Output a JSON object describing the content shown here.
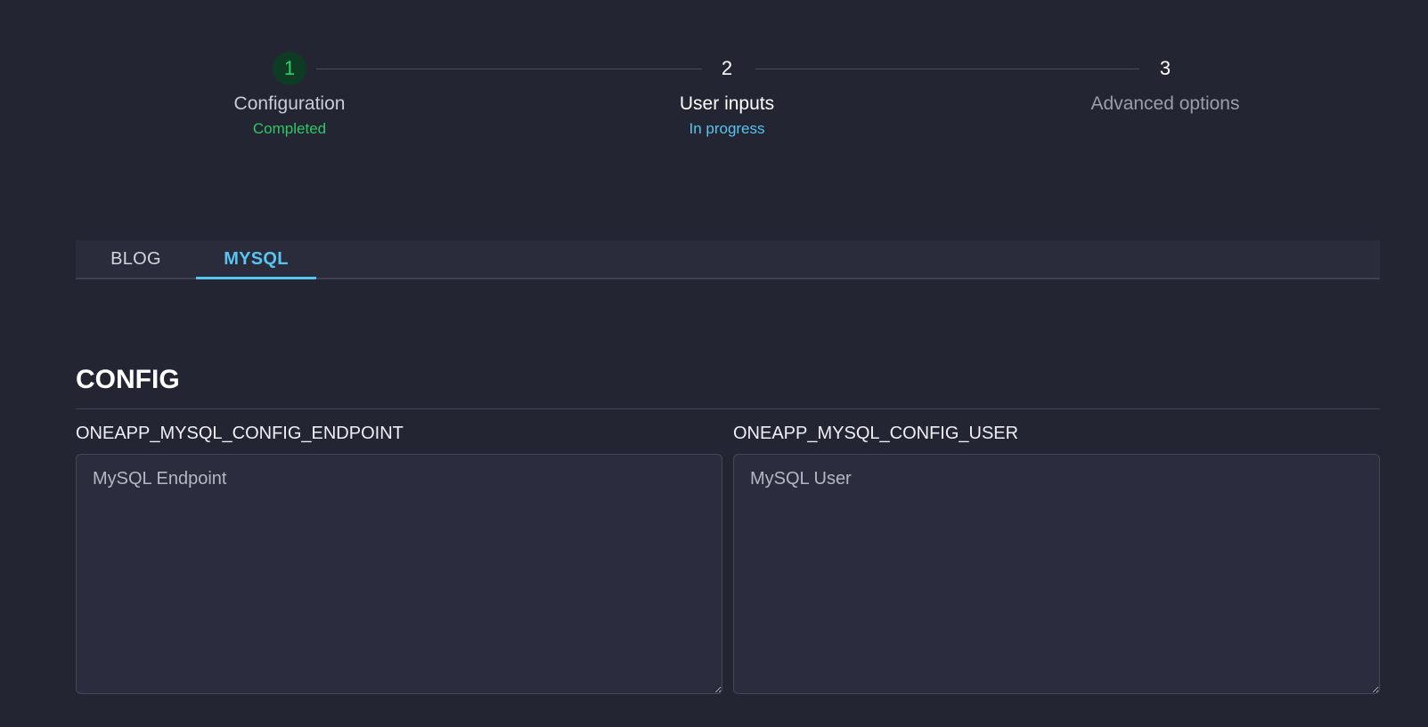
{
  "stepper": {
    "steps": [
      {
        "number": "1",
        "title": "Configuration",
        "status": "Completed",
        "state": "completed"
      },
      {
        "number": "2",
        "title": "User inputs",
        "status": "In progress",
        "state": "active"
      },
      {
        "number": "3",
        "title": "Advanced options",
        "status": "",
        "state": "pending"
      }
    ]
  },
  "tabs": [
    {
      "label": "BLOG",
      "active": false
    },
    {
      "label": "MYSQL",
      "active": true
    }
  ],
  "section": {
    "title": "CONFIG",
    "fields": [
      {
        "label": "ONEAPP_MYSQL_CONFIG_ENDPOINT",
        "value": "",
        "placeholder": "MySQL Endpoint"
      },
      {
        "label": "ONEAPP_MYSQL_CONFIG_USER",
        "value": "",
        "placeholder": "MySQL User"
      }
    ]
  },
  "colors": {
    "background": "#232533",
    "completed": "#2fc765",
    "active": "#58c4f0",
    "panel": "#2a2c3b"
  }
}
